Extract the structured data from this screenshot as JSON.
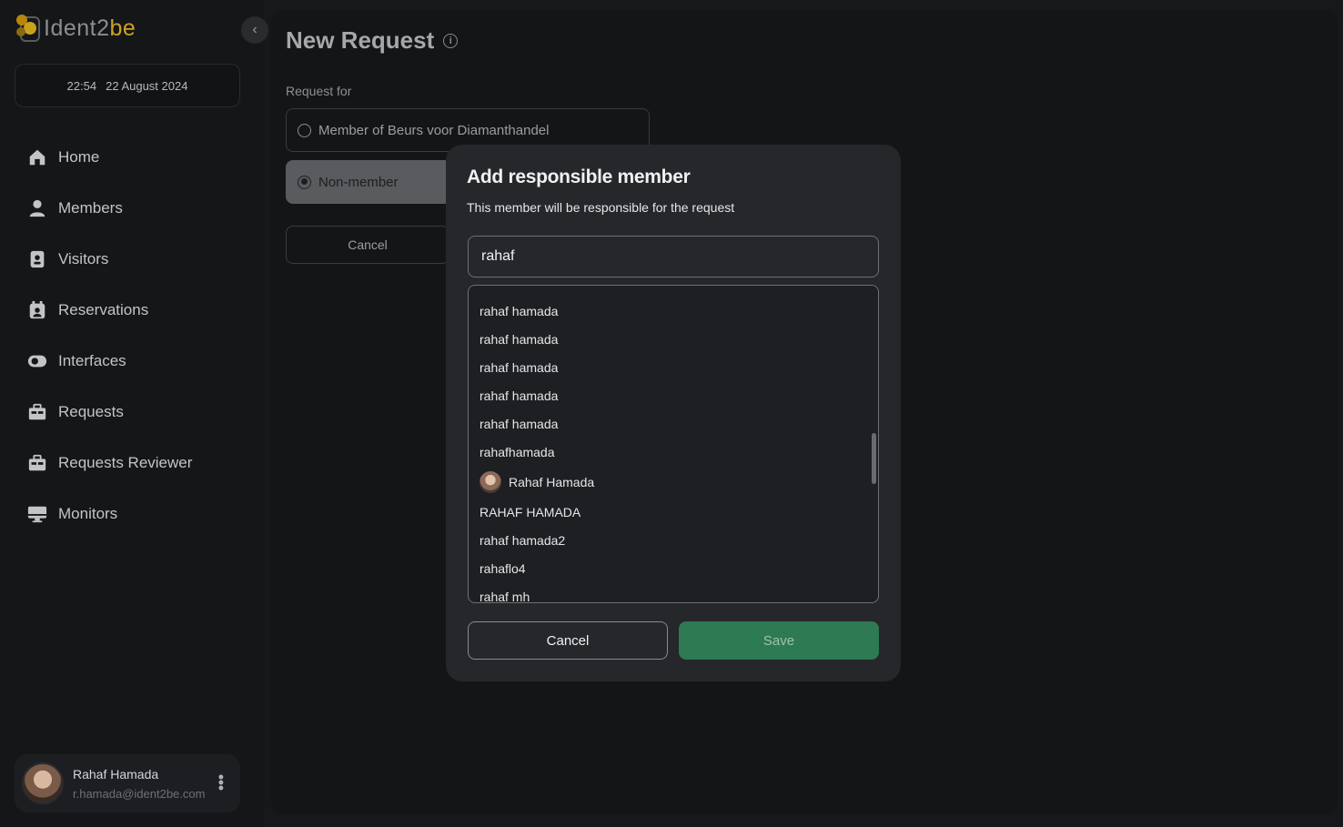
{
  "app": {
    "logo_prefix": "Ident2",
    "logo_accent": "be"
  },
  "header": {
    "time": "22:54",
    "date": "22 August 2024"
  },
  "sidebar": {
    "items": [
      {
        "label": "Home",
        "icon": "home-icon"
      },
      {
        "label": "Members",
        "icon": "person-icon"
      },
      {
        "label": "Visitors",
        "icon": "badge-icon"
      },
      {
        "label": "Reservations",
        "icon": "calendar-person-icon"
      },
      {
        "label": "Interfaces",
        "icon": "toggle-icon"
      },
      {
        "label": "Requests",
        "icon": "briefcase-icon"
      },
      {
        "label": "Requests Reviewer",
        "icon": "briefcase-icon"
      },
      {
        "label": "Monitors",
        "icon": "monitor-icon"
      }
    ],
    "collapse_icon": "chevron-left-icon"
  },
  "user": {
    "name": "Rahaf Hamada",
    "email": "r.hamada@ident2be.com"
  },
  "page": {
    "title": "New Request",
    "request_for_label": "Request for",
    "option_member": "Member of Beurs voor Diamanthandel",
    "option_nonmember": "Non-member",
    "selected_option": "Non-member",
    "cancel_label": "Cancel"
  },
  "modal": {
    "title": "Add responsible member",
    "subtitle": "This member will be responsible for the request",
    "search_value": "rahaf",
    "results": [
      "rahaf hamada",
      "rahaf hamada",
      "rahaf hamada",
      "rahaf hamada",
      "rahaf hamada",
      "rahafhamada",
      "Rahaf Hamada",
      "RAHAF HAMADA",
      "rahaf hamada2",
      "rahaflo4",
      "rahaf mh"
    ],
    "cancel_label": "Cancel",
    "save_label": "Save"
  },
  "colors": {
    "accent": "#c9a227",
    "save_button": "#2e7a52",
    "background": "#17181a"
  }
}
